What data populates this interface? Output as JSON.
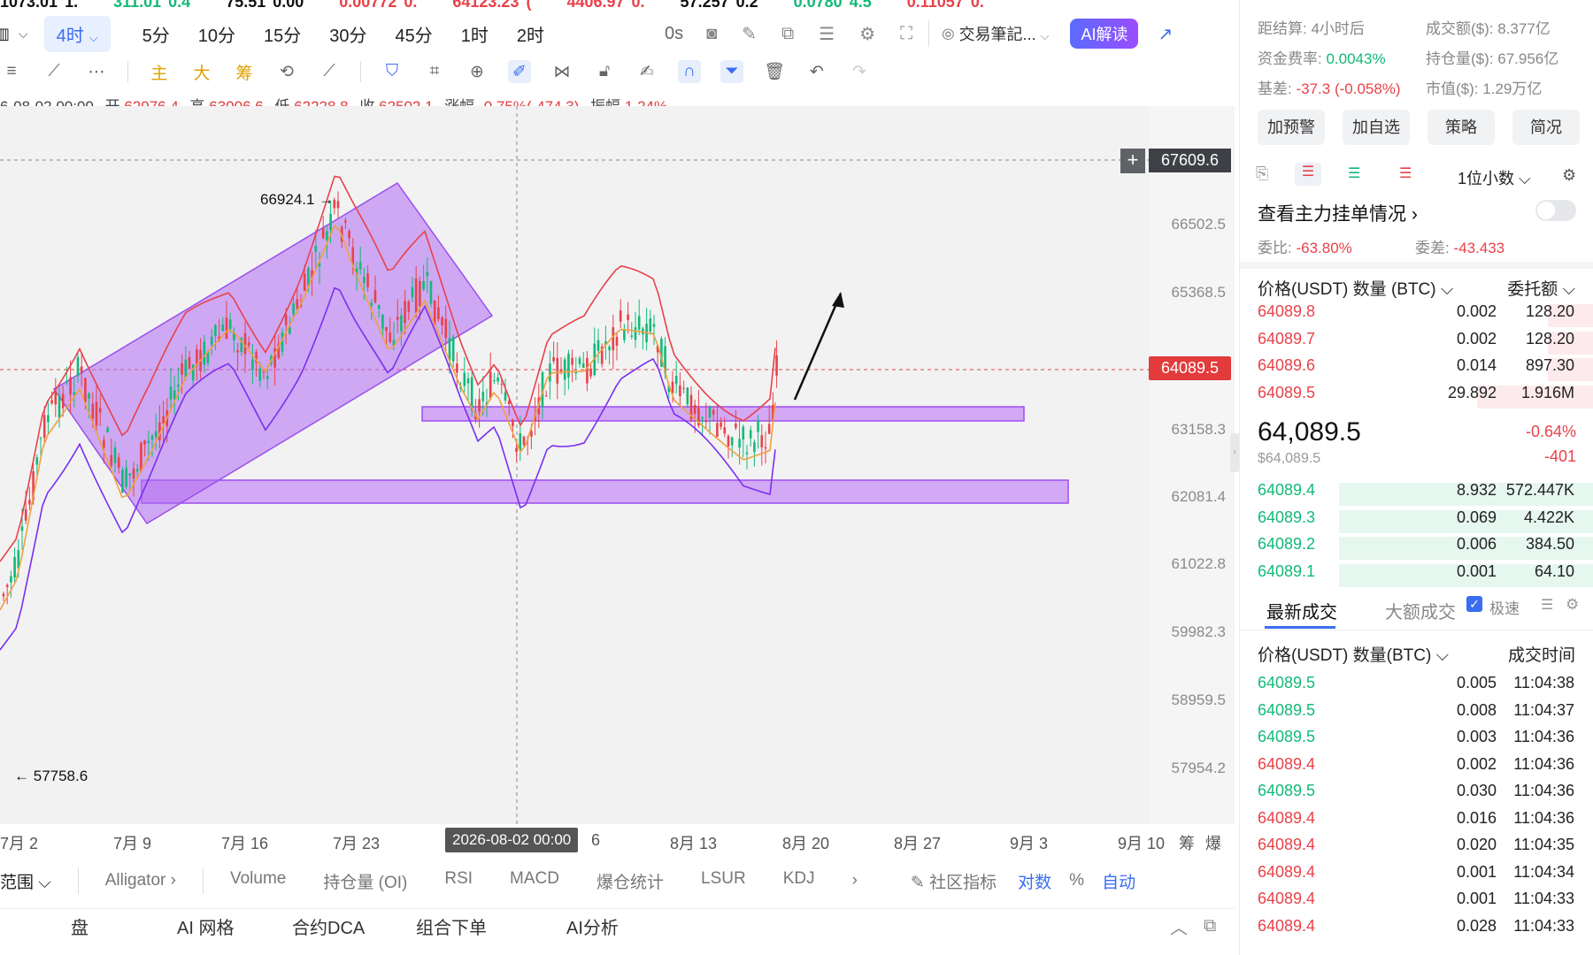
{
  "ticker_strip": [
    "1073.01",
    "1.",
    "311.01",
    "0.4",
    "75.51",
    "0.00",
    "0.00772",
    "0.",
    "64123.23",
    "(",
    "4406.97",
    "0.",
    "57.257",
    "0.2",
    "0.0780",
    "4.5",
    "0.11057",
    "0."
  ],
  "timeframes": [
    "4时",
    "5分",
    "10分",
    "15分",
    "30分",
    "45分",
    "1时",
    "2时"
  ],
  "active_timeframe": "4时",
  "toolbar": {
    "latency": "0s",
    "trade_notes": "交易筆記...",
    "ai_button": "AI解读"
  },
  "draw_tools_labels": [
    "主",
    "大",
    "筹"
  ],
  "ohlc": {
    "date": "6-08-02 00:00",
    "open_label": "开",
    "open": "62976.4",
    "high_label": "高",
    "high": "63006.6",
    "low_label": "低",
    "low": "62228.8",
    "close_label": "收",
    "close": "62502.1",
    "change_label": "涨幅",
    "change": "-0.75%(-474.3)",
    "amp_label": "振幅",
    "amp": "1.24%"
  },
  "price_axis": [
    "66502.5",
    "65368.5",
    "63158.3",
    "62081.4",
    "61022.8",
    "59982.3",
    "58959.5",
    "57954.2"
  ],
  "crosshair_price": "67609.6",
  "last_price_tag": "64089.5",
  "date_axis": [
    "7月 2",
    "7月 9",
    "7月 16",
    "7月 23",
    "6",
    "8月 13",
    "8月 20",
    "8月 27",
    "9月 3",
    "9月 10"
  ],
  "date_axis_right": [
    "筹",
    "爆"
  ],
  "crosshair_date": "2026-08-02 00:00",
  "annotations": {
    "high": "66924.1",
    "low": "57758.6"
  },
  "indicator_row": {
    "range": "范围",
    "alligator": "Alligator",
    "tabs": [
      "Volume",
      "持仓量 (OI)",
      "RSI",
      "MACD",
      "爆仓统计",
      "LSUR",
      "KDJ"
    ],
    "community": "社区指标",
    "log": "对数",
    "percent": "%",
    "auto": "自动"
  },
  "bottom_tabs": [
    "盘",
    "AI 网格",
    "合约DCA",
    "组合下单",
    "AI分析"
  ],
  "right_panel": {
    "settle": {
      "label": "距结算:",
      "value": "4小时后"
    },
    "turnover": {
      "label": "成交额($):",
      "value": "8.377亿"
    },
    "funding": {
      "label": "资金费率:",
      "value": "0.0043%"
    },
    "oi": {
      "label": "持仓量($):",
      "value": "67.956亿"
    },
    "basis": {
      "label": "基差:",
      "value": "-37.3 (-0.058%)"
    },
    "mcap": {
      "label": "市值($):",
      "value": "1.29万亿"
    },
    "buttons": [
      "加预警",
      "加自选",
      "策略",
      "简况"
    ],
    "decimals": "1位小数",
    "main_orders": "查看主力挂单情况",
    "ratio": {
      "label": "委比:",
      "value": "-63.80%"
    },
    "diff": {
      "label": "委差:",
      "value": "-43.433"
    },
    "ob_header": {
      "price": "价格(USDT)",
      "qty": "数量 (BTC)",
      "amt": "委托额"
    },
    "asks": [
      {
        "p": "64089.8",
        "q": "0.002",
        "t": "128.20",
        "w": 0.13
      },
      {
        "p": "64089.7",
        "q": "0.002",
        "t": "128.20",
        "w": 0.13
      },
      {
        "p": "64089.6",
        "q": "0.014",
        "t": "897.30",
        "w": 0.13
      },
      {
        "p": "64089.5",
        "q": "29.892",
        "t": "1.916M",
        "w": 0.33
      }
    ],
    "last_price": "64,089.5",
    "last_price_usd": "$64,089.5",
    "change_pct": "-0.64%",
    "change_abs": "-401",
    "bids": [
      {
        "p": "64089.4",
        "q": "8.932",
        "t": "572.447K",
        "w": 0.72
      },
      {
        "p": "64089.3",
        "q": "0.069",
        "t": "4.422K",
        "w": 0.72
      },
      {
        "p": "64089.2",
        "q": "0.006",
        "t": "384.50",
        "w": 0.72
      },
      {
        "p": "64089.1",
        "q": "0.001",
        "t": "64.10",
        "w": 0.72
      }
    ],
    "trades_tab": "最新成交",
    "big_trades": "大额成交",
    "fast": "极速",
    "trades_header": {
      "price": "价格(USDT)",
      "qty": "数量(BTC)",
      "time": "成交时间"
    },
    "trades": [
      {
        "p": "64089.5",
        "q": "0.005",
        "t": "11:04:38",
        "c": "green"
      },
      {
        "p": "64089.5",
        "q": "0.008",
        "t": "11:04:37",
        "c": "green"
      },
      {
        "p": "64089.5",
        "q": "0.003",
        "t": "11:04:36",
        "c": "green"
      },
      {
        "p": "64089.4",
        "q": "0.002",
        "t": "11:04:36",
        "c": "red"
      },
      {
        "p": "64089.5",
        "q": "0.030",
        "t": "11:04:36",
        "c": "green"
      },
      {
        "p": "64089.4",
        "q": "0.016",
        "t": "11:04:36",
        "c": "red"
      },
      {
        "p": "64089.4",
        "q": "0.020",
        "t": "11:04:35",
        "c": "red"
      },
      {
        "p": "64089.4",
        "q": "0.001",
        "t": "11:04:34",
        "c": "red"
      },
      {
        "p": "64089.4",
        "q": "0.001",
        "t": "11:04:33",
        "c": "red"
      },
      {
        "p": "64089.4",
        "q": "0.028",
        "t": "11:04:33",
        "c": "red"
      }
    ]
  },
  "colors": {
    "up": "#12b97a",
    "down": "#e8424a",
    "accent": "#3a6df0",
    "channel": "#b16cf0"
  }
}
